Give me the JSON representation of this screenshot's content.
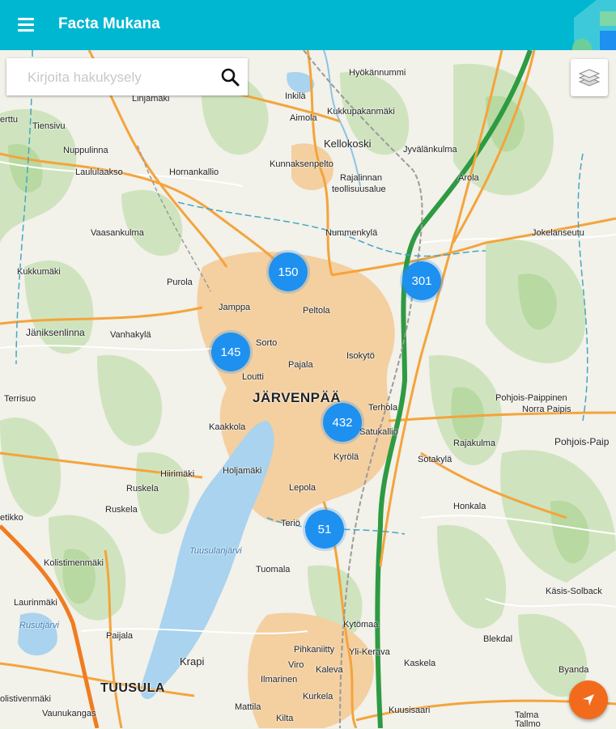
{
  "app": {
    "title": "Facta Mukana",
    "menu_icon": "hamburger-menu-icon",
    "accent_color": "#00b7d1"
  },
  "search": {
    "placeholder": "Kirjoita hakukysely",
    "icon": "search-icon"
  },
  "map_controls": {
    "layers_icon": "layers-icon",
    "locate_icon": "navigation-arrow-icon",
    "locate_color": "#f26b1d"
  },
  "clusters": [
    {
      "count": "150"
    },
    {
      "count": "301"
    },
    {
      "count": "145"
    },
    {
      "count": "432"
    },
    {
      "count": "51"
    }
  ],
  "place_labels": {
    "hyokannummi": "Hyökännummi",
    "linjamaki": "Linjamäki",
    "inkila": "Inkilä",
    "kukkupakanmaki": "Kukkupakanmäki",
    "aimola": "Aimola",
    "kellokoski": "Kellokoski",
    "jyvalankulma": "Jyvälänkulma",
    "tiensivu": "Tiensivu",
    "nuppulinna": "Nuppulinna",
    "laululaakso": "Laululaakso",
    "hornankallio": "Hornankallio",
    "kunnaksenpelto": "Kunnaksenpelto",
    "rajalinnan": "Rajalinnan",
    "teollisuusalue": "teollisuusalue",
    "arola": "Arola",
    "vaasankulma": "Vaasankulma",
    "nummenkyla": "Nummenkylä",
    "jokelanseutu": "Jokelanseutu",
    "kukkumaki": "Kukkumäki",
    "purola": "Purola",
    "jamppa": "Jamppa",
    "peltola": "Peltola",
    "janiksenlinna": "Jäniksenlinna",
    "vanhakyla": "Vanhakylä",
    "sorto": "Sorto",
    "isokyto": "Isokytö",
    "pajala": "Pajala",
    "loutti": "Loutti",
    "jarvenpaa": "JÄRVENPÄÄ",
    "terhola": "Terhola",
    "pohjois_paippinen": "Pohjois-Paippinen",
    "norra_paipis": "Norra Paipis",
    "terrisuo": "Terrisuo",
    "kaakkola": "Kaakkola",
    "satukallio": "Satukallio",
    "rajakulma": "Rajakulma",
    "pohjois_paip": "Pohjois-Paip",
    "hiirimaki": "Hiirimäki",
    "holjamaki": "Holjamäki",
    "kyrola": "Kyrölä",
    "sotakyla": "Sotakylä",
    "ruskela": "Ruskela",
    "lepola": "Lepola",
    "honkala": "Honkala",
    "etikko": "etikko",
    "terio": "Teriö",
    "tuusulanjarvi": "Tuusulanjärvi",
    "kolistimenmaki": "Kolistimenmäki",
    "tuomala": "Tuomala",
    "kasis_solback": "Käsis-Solback",
    "laurinmaki": "Laurinmäki",
    "rusutjarvi": "Rusutjärvi",
    "paijala": "Paijala",
    "kytomaa": "Kytömaa",
    "blekdal": "Blekdal",
    "pihkaniitty": "Pihkaniitty",
    "yli_kerava": "Yli-Kerava",
    "krapi": "Krapi",
    "viro": "Viro",
    "kaleva": "Kaleva",
    "kaskela": "Kaskela",
    "byanda": "Byanda",
    "tuusula": "TUUSULA",
    "ilmarinen": "Ilmarinen",
    "kurkela": "Kurkela",
    "kolistivenmaki": "olistivenmäki",
    "vaunukangas": "Vaunukangas",
    "mattila": "Mattila",
    "kuusisaari": "Kuusisaari",
    "kilta": "Kilta",
    "talma": "Talma",
    "tallmo": "Tallmo",
    "erttu": "erttu"
  }
}
